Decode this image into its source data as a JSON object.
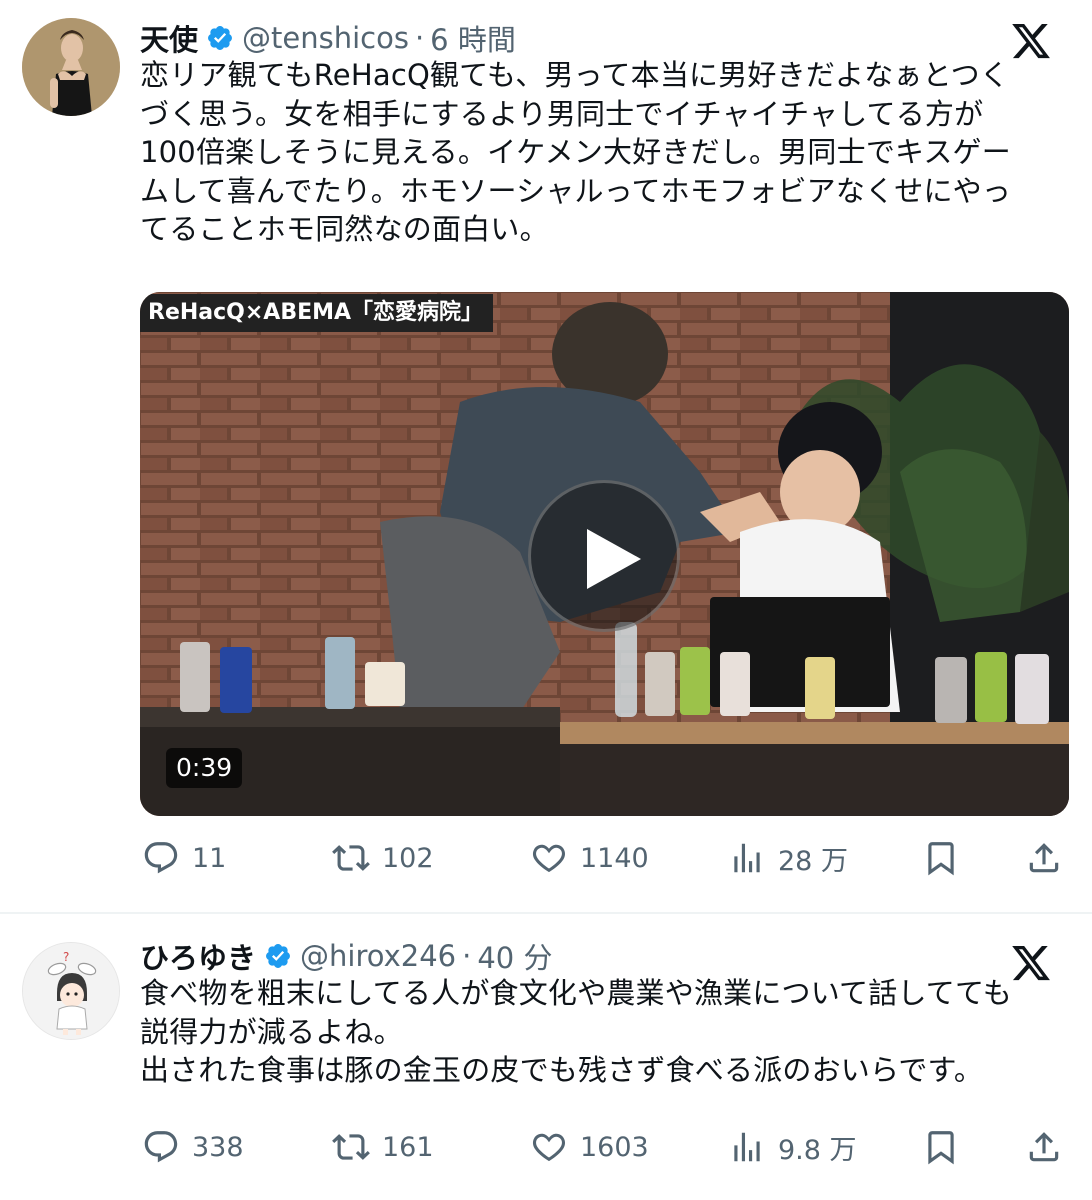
{
  "tweets": [
    {
      "name": "天使",
      "handle": "@tenshicos",
      "separator": "·",
      "time": "6 時間",
      "lines": [
        "恋リア観てもReHacQ観ても、男って本当に男好きだよなぁとつく",
        "づく思う。女を相手にするより男同士でイチャイチャしてる方が",
        "100倍楽しそうに見える。イケメン大好きだし。男同士でキスゲー",
        "ムして喜んでたり。ホモソーシャルってホモフォビアなくせにやっ",
        "てることホモ同然なの面白い。"
      ],
      "media": {
        "caption": "ReHacQ×ABEMA「恋愛病院」",
        "duration": "0:39"
      },
      "stats": {
        "replies": "11",
        "retweets": "102",
        "likes": "1140",
        "views": "28 万"
      }
    },
    {
      "name": "ひろゆき",
      "handle": "@hirox246",
      "separator": "·",
      "time": "40 分",
      "lines": [
        "食べ物を粗末にしてる人が食文化や農業や漁業について話してても",
        "説得力が減るよね。",
        "出された食事は豚の金玉の皮でも残さず食べる派のおいらです。"
      ],
      "stats": {
        "replies": "338",
        "retweets": "161",
        "likes": "1603",
        "views": "9.8 万"
      }
    }
  ],
  "icons": {
    "verified": "verified-badge-icon",
    "platform": "x-logo-icon",
    "reply": "reply-bubble-icon",
    "retweet": "retweet-icon",
    "like": "heart-icon",
    "views": "views-bar-chart-icon",
    "bookmark": "bookmark-icon",
    "share": "share-upload-icon",
    "play": "play-icon"
  },
  "colors": {
    "verified": "#1d9bf0",
    "text": "#0f1419",
    "secondary": "#536471",
    "divider": "#eff3f4"
  }
}
